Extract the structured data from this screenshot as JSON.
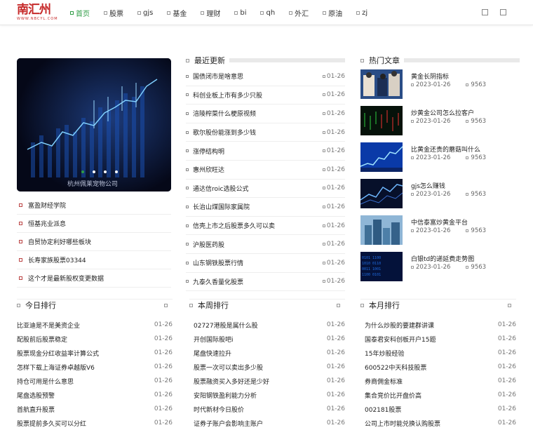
{
  "header": {
    "logo_text": "南汇州",
    "logo_sub": "WWW.NBCYL.COM",
    "nav": [
      {
        "label": "首页",
        "active": true
      },
      {
        "label": "股票"
      },
      {
        "label": "gjs"
      },
      {
        "label": "基金"
      },
      {
        "label": "理财"
      },
      {
        "label": "bi"
      },
      {
        "label": "qh"
      },
      {
        "label": "外汇"
      },
      {
        "label": "原油"
      },
      {
        "label": "zj"
      }
    ]
  },
  "banner": {
    "caption": "杭州佩莱宠物公司"
  },
  "left_links": [
    "富盈财经学院",
    "恒基兆业派息",
    "自贸协定利好哪些板块",
    "长寿家族股票03344",
    "这个才是最新股权变更数据"
  ],
  "latest": {
    "title": "最近更新",
    "items": [
      {
        "title": "国债闭市是啥意思",
        "date": "01-26"
      },
      {
        "title": "科创业板上市有多少只股",
        "date": "01-26"
      },
      {
        "title": "涪陵榨菜什么梗原视频",
        "date": "01-26"
      },
      {
        "title": "歌尔股份能涨到多少钱",
        "date": "01-26"
      },
      {
        "title": "涨停结构明",
        "date": "01-26"
      },
      {
        "title": "惠州欣旺达",
        "date": "01-26"
      },
      {
        "title": "通达信roic选股公式",
        "date": "01-26"
      },
      {
        "title": "长治山煤国际家属院",
        "date": "01-26"
      },
      {
        "title": "信壳上市之后股票多久可以卖",
        "date": "01-26"
      },
      {
        "title": "沪股医药股",
        "date": "01-26"
      },
      {
        "title": "山东钢铁股票行情",
        "date": "01-26"
      },
      {
        "title": "九泰久香量化股票",
        "date": "01-26"
      }
    ]
  },
  "hot": {
    "title": "热门文章",
    "items": [
      {
        "title": "黄金长阴指标",
        "date": "2023-01-26",
        "views": "9563"
      },
      {
        "title": "炒黄金公司怎么拉客户",
        "date": "2023-01-26",
        "views": "9563"
      },
      {
        "title": "比黄金还贵的蘑菇叫什么",
        "date": "2023-01-26",
        "views": "9563"
      },
      {
        "title": "gjs怎么赚钱",
        "date": "2023-01-26",
        "views": "9563"
      },
      {
        "title": "中信泰富炒黄金平台",
        "date": "2023-01-26",
        "views": "9563"
      },
      {
        "title": "白银td的递延费走势图",
        "date": "2023-01-26",
        "views": "9563"
      }
    ]
  },
  "rank_today": {
    "title": "今日排行",
    "items": [
      {
        "title": "比亚迪是不是美资企业",
        "date": "01-26"
      },
      {
        "title": "配股前后股票稳定",
        "date": "01-26"
      },
      {
        "title": "股票现金分红收益率计算公式",
        "date": "01-26"
      },
      {
        "title": "怎样下载上海证券卓越版V6",
        "date": "01-26"
      },
      {
        "title": "持仓可用是什么意思",
        "date": "01-26"
      },
      {
        "title": "尾盘选股预警",
        "date": "01-26"
      },
      {
        "title": "首航直升股票",
        "date": "01-26"
      },
      {
        "title": "股票提前多久买可以分红",
        "date": "01-26"
      }
    ]
  },
  "rank_week": {
    "title": "本周排行",
    "items": [
      {
        "title": "02727港股是属什么股",
        "date": "01-26"
      },
      {
        "title": "开创国际股吧i",
        "date": "01-26"
      },
      {
        "title": "尾盘快速拉升",
        "date": "01-26"
      },
      {
        "title": "股票一次可以卖出多少股",
        "date": "01-26"
      },
      {
        "title": "股票融资买入多好还是少好",
        "date": "01-26"
      },
      {
        "title": "安阳钢铁盈利能力分析",
        "date": "01-26"
      },
      {
        "title": "时代新材今日股价",
        "date": "01-26"
      },
      {
        "title": "证券子账户会影响主账户",
        "date": "01-26"
      }
    ]
  },
  "rank_month": {
    "title": "本月排行",
    "items": [
      {
        "title": "为什么炒股的要建群讲课",
        "date": "01-26"
      },
      {
        "title": "国泰君安科创板开户15题",
        "date": "01-26"
      },
      {
        "title": "15年炒股经验",
        "date": "01-26"
      },
      {
        "title": "600522中天科技股票",
        "date": "01-26"
      },
      {
        "title": "券商佣金标准",
        "date": "01-26"
      },
      {
        "title": "集合竞价比开盘价高",
        "date": "01-26"
      },
      {
        "title": "002181股票",
        "date": "01-26"
      },
      {
        "title": "公司上市时能兑换认购股票",
        "date": "01-26"
      }
    ]
  },
  "colors": {
    "accent": "#2e9c45",
    "logo": "#c62828"
  }
}
